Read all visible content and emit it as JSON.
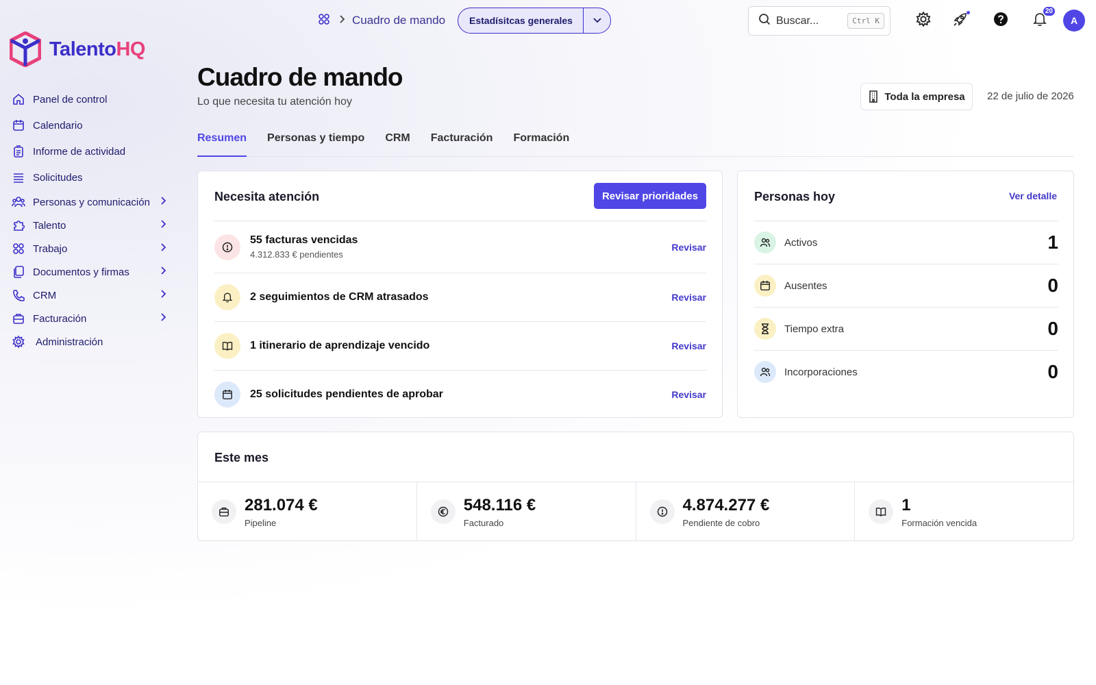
{
  "brand": {
    "name_part1": "Talento",
    "name_part2": "HQ",
    "primary": "#4f46e5",
    "accent": "#e8417b"
  },
  "sidebar": {
    "items": [
      {
        "label": "Panel de control",
        "icon": "home-icon",
        "has_children": false
      },
      {
        "label": "Calendario",
        "icon": "calendar-icon",
        "has_children": false
      },
      {
        "label": "Informe de actividad",
        "icon": "report-icon",
        "has_children": false
      },
      {
        "label": "Solicitudes",
        "icon": "list-icon",
        "has_children": false
      },
      {
        "label": "Personas y comunicación",
        "icon": "people-icon",
        "has_children": true
      },
      {
        "label": "Talento",
        "icon": "puzzle-icon",
        "has_children": true
      },
      {
        "label": "Trabajo",
        "icon": "grid-icon",
        "has_children": true
      },
      {
        "label": "Documentos y firmas",
        "icon": "documents-icon",
        "has_children": true
      },
      {
        "label": "CRM",
        "icon": "phone-icon",
        "has_children": true
      },
      {
        "label": "Facturación",
        "icon": "briefcase-icon",
        "has_children": true
      },
      {
        "label": "Administración",
        "icon": "gear-icon",
        "has_children": false
      }
    ]
  },
  "topbar": {
    "breadcrumb": "Cuadro de mando",
    "view_select": "Estadísitcas generales",
    "search": {
      "placeholder": "Buscar...",
      "shortcut": "Ctrl K"
    },
    "notifications_count": "20",
    "avatar_initial": "A"
  },
  "header": {
    "title": "Cuadro de mando",
    "subtitle": "Lo que necesita tu atención hoy",
    "scope_button": "Toda la empresa",
    "date": "22 de julio de 2026"
  },
  "tabs": [
    {
      "label": "Resumen",
      "active": true
    },
    {
      "label": "Personas y tiempo",
      "active": false
    },
    {
      "label": "CRM",
      "active": false
    },
    {
      "label": "Facturación",
      "active": false
    },
    {
      "label": "Formación",
      "active": false
    }
  ],
  "attention": {
    "title": "Necesita atención",
    "action": "Revisar prioridades",
    "items": [
      {
        "title": "55 facturas vencidas",
        "subtitle": "4.312.833 € pendientes",
        "link": "Revisar",
        "icon": "alert-circle-icon",
        "tone": "red"
      },
      {
        "title": "2 seguimientos de CRM atrasados",
        "subtitle": "",
        "link": "Revisar",
        "icon": "bell-icon",
        "tone": "yellow"
      },
      {
        "title": "1 itinerario de aprendizaje vencido",
        "subtitle": "",
        "link": "Revisar",
        "icon": "book-icon",
        "tone": "yellow"
      },
      {
        "title": "25 solicitudes pendientes de aprobar",
        "subtitle": "",
        "link": "Revisar",
        "icon": "calendar-icon",
        "tone": "blue"
      }
    ]
  },
  "people_today": {
    "title": "Personas hoy",
    "link": "Ver detalle",
    "rows": [
      {
        "label": "Activos",
        "value": "1",
        "icon": "users-icon",
        "tone": "green"
      },
      {
        "label": "Ausentes",
        "value": "0",
        "icon": "calendar-icon",
        "tone": "yellow"
      },
      {
        "label": "Tiempo extra",
        "value": "0",
        "icon": "hourglass-icon",
        "tone": "yellow"
      },
      {
        "label": "Incorporaciones",
        "value": "0",
        "icon": "users-icon",
        "tone": "blue"
      }
    ]
  },
  "this_month": {
    "title": "Este mes",
    "stats": [
      {
        "value": "281.074 €",
        "label": "Pipeline",
        "icon": "briefcase-icon"
      },
      {
        "value": "548.116 €",
        "label": "Facturado",
        "icon": "euro-icon"
      },
      {
        "value": "4.874.277 €",
        "label": "Pendiente de cobro",
        "icon": "alert-circle-icon"
      },
      {
        "value": "1",
        "label": "Formación vencida",
        "icon": "book-icon"
      }
    ]
  }
}
